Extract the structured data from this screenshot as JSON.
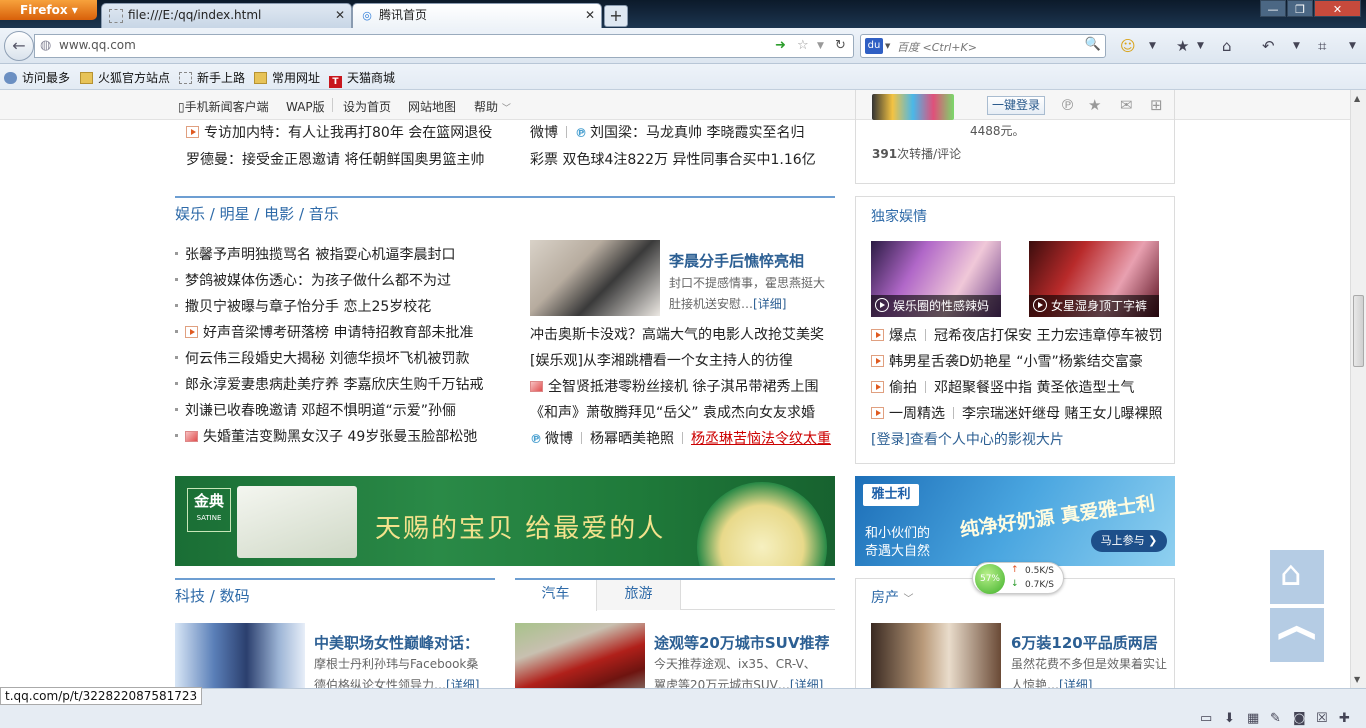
{
  "browser": {
    "app_button": "Firefox",
    "tabs": [
      {
        "label": "file:///E:/qq/index.html"
      },
      {
        "label": "腾讯首页"
      }
    ],
    "url": "www.qq.com",
    "search_placeholder": "百度 <Ctrl+K>",
    "bookmarks": [
      "访问最多",
      "火狐官方站点",
      "新手上路",
      "常用网址",
      "天猫商城"
    ],
    "status_url": "t.qq.com/p/t/322822087581723"
  },
  "topnav": {
    "links": [
      "手机新闻客户端",
      "WAP版",
      "设为首页",
      "网站地图",
      "帮助"
    ],
    "login": "一键登录"
  },
  "top_news": {
    "left": [
      "专访加内特：有人让我再打80年 会在篮网退役",
      "罗德曼：接受金正恩邀请 将任朝鲜国奥男篮主帅"
    ],
    "right_row1_a": "微博",
    "right_row1_b": "刘国梁：马龙真帅 李晓霞实至名归",
    "right_row2": "彩票 双色球4注822万 异性同事合买中1.16亿"
  },
  "top_right": {
    "price_text": "4488元。",
    "count": "391",
    "count_label": "次转播/评论"
  },
  "ent": {
    "title": "娱乐 / 明星 / 电影 / 音乐",
    "list": [
      "张馨予声明独揽骂名 被指耍心机逼李晨封口",
      "梦鸽被媒体伤透心：为孩子做什么都不为过",
      "撒贝宁被曝与章子怡分手 恋上25岁校花",
      "好声音梁博考研落榜 申请特招教育部未批准",
      "何云伟三段婚史大揭秘 刘德华损坏飞机被罚款",
      "郎永淳爱妻患病赴美疗养 李嘉欣庆生购千万钻戒",
      "刘谦已收春晚邀请 邓超不惧明道“示爱”孙俪",
      "失婚董洁变黝黑女汉子 49岁张曼玉脸部松弛"
    ],
    "headline": "李晨分手后憔悴亮相",
    "summary": "封口不提感情事，霍思燕挺大肚接机送安慰…",
    "more": "[详细]",
    "right_list": [
      "冲击奥斯卡没戏？高端大气的电影人改抢艾美奖",
      "[娱乐观]从李湘跳槽看一个女主持人的彷徨",
      "全智贤抵港零粉丝接机 徐子淇吊带裙秀上围",
      "《和声》萧敬腾拜见“岳父” 袁成杰向女友求婚"
    ],
    "last_a": "微博",
    "last_b": "杨幂晒美艳照",
    "last_c": "杨丞琳苦恼法令纹太重"
  },
  "exclusive": {
    "title": "独家娱情",
    "pic1": "娱乐圈的性感辣妈",
    "pic2": "女星湿身顶丁字裤",
    "rows": [
      {
        "tag": "爆点",
        "text": "冠希夜店打保安 王力宏违章停车被罚"
      },
      {
        "tag": "韩男星舌袭D奶艳星 “小雪”杨紫结交富豪",
        "text": ""
      },
      {
        "tag": "偷拍",
        "text": "邓超聚餐竖中指 黄圣依造型土气"
      },
      {
        "tag": "一周精选",
        "text": "李宗瑞迷奸继母 赌王女儿曝裸照"
      }
    ],
    "login_link": "[登录]查看个人中心的影视大片"
  },
  "ads": {
    "banner_brand": "金典",
    "banner_brand_sub": "SATINE",
    "banner_text": "天赐的宝贝 给最爱的人",
    "side_brand": "雅士利",
    "side_line1": "和小伙们的",
    "side_line2": "奇遇大自然",
    "side_slogan": "纯净好奶源 真爱雅士利",
    "side_button": "马上参与"
  },
  "tech": {
    "title": "科技 / 数码",
    "headline": "中美职场女性巅峰对话：",
    "summary": "摩根士丹利孙玮与Facebook桑德伯格纵论女性领导力…",
    "more": "[详细]"
  },
  "auto": {
    "tab1": "汽车",
    "tab2": "旅游",
    "headline": "途观等20万城市SUV推荐",
    "summary": "今天推荐途观、ix35、CR-V、翼虎等20万元城市SUV…",
    "more": "[详细]"
  },
  "house": {
    "title": "房产",
    "headline": "6万装120平品质两居",
    "summary": "虽然花费不多但是效果着实让人惊艳…",
    "more": "[详细]"
  },
  "netspeed": {
    "percent": "57%",
    "up": "0.5K/S",
    "down": "0.7K/S"
  },
  "colors": {
    "accent": "#2e6aa8",
    "section_line": "#6d9ed2",
    "banner_green": "#1f7a3a"
  }
}
